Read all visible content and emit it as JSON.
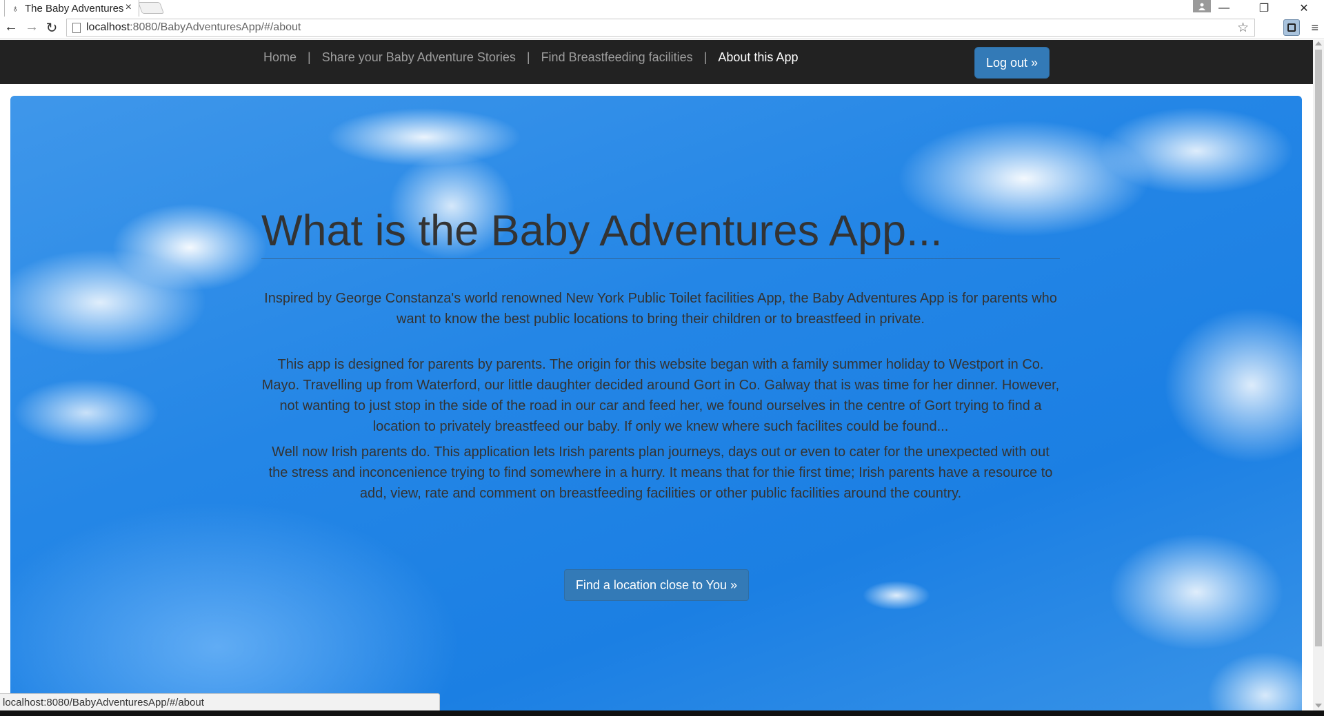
{
  "browser": {
    "tab_title": "The Baby Adventures",
    "tab_favicon": "person-icon",
    "url_host": "localhost",
    "url_path": ":8080/BabyAdventuresApp/#/about",
    "status_url": "localhost:8080/BabyAdventuresApp/#/about",
    "icons": {
      "back": "←",
      "forward": "→",
      "reload": "↻",
      "star": "☆",
      "menu": "≡",
      "close": "✕",
      "minimize": "—",
      "restore": "❐",
      "tab_close": "×"
    }
  },
  "navbar": {
    "links": [
      {
        "label": "Home",
        "active": false
      },
      {
        "label": "Share your Baby Adventure Stories",
        "active": false
      },
      {
        "label": "Find Breastfeeding facilities",
        "active": false
      },
      {
        "label": "About this App",
        "active": true
      }
    ],
    "separator": "|",
    "logout_label": "Log out »"
  },
  "main": {
    "headline": "What is the Baby Adventures App...",
    "paragraphs": [
      "Inspired by George Constanza's world renowned New York Public Toilet facilities App, the Baby Adventures App is for parents who want to know the best public locations to bring their children or to breastfeed in private.",
      "This app is designed for parents by parents. The origin for this website began with a family summer holiday to Westport in Co. Mayo. Travelling up from Waterford, our little daughter decided around Gort in Co. Galway that is was time for her dinner. However, not wanting to just stop in the side of the road in our car and feed her, we found ourselves in the centre of Gort trying to find a location to privately breastfeed our baby. If only we knew where such facilites could be found...",
      "Well now Irish parents do. This application lets Irish parents plan journeys, days out or even to cater for the unexpected with out the stress and inconcenience trying to find somewhere in a hurry. It means that for thie first time; Irish parents have a resource to add, view, rate and comment on breastfeeding facilities or other public facilities around the country."
    ],
    "cta_label": "Find a location close to You »"
  },
  "colors": {
    "navbar_bg": "#222222",
    "nav_link": "#9d9d9d",
    "nav_link_active": "#ffffff",
    "primary_button": "#337ab7",
    "sky_blue": "#2486e6",
    "text": "#333333"
  }
}
